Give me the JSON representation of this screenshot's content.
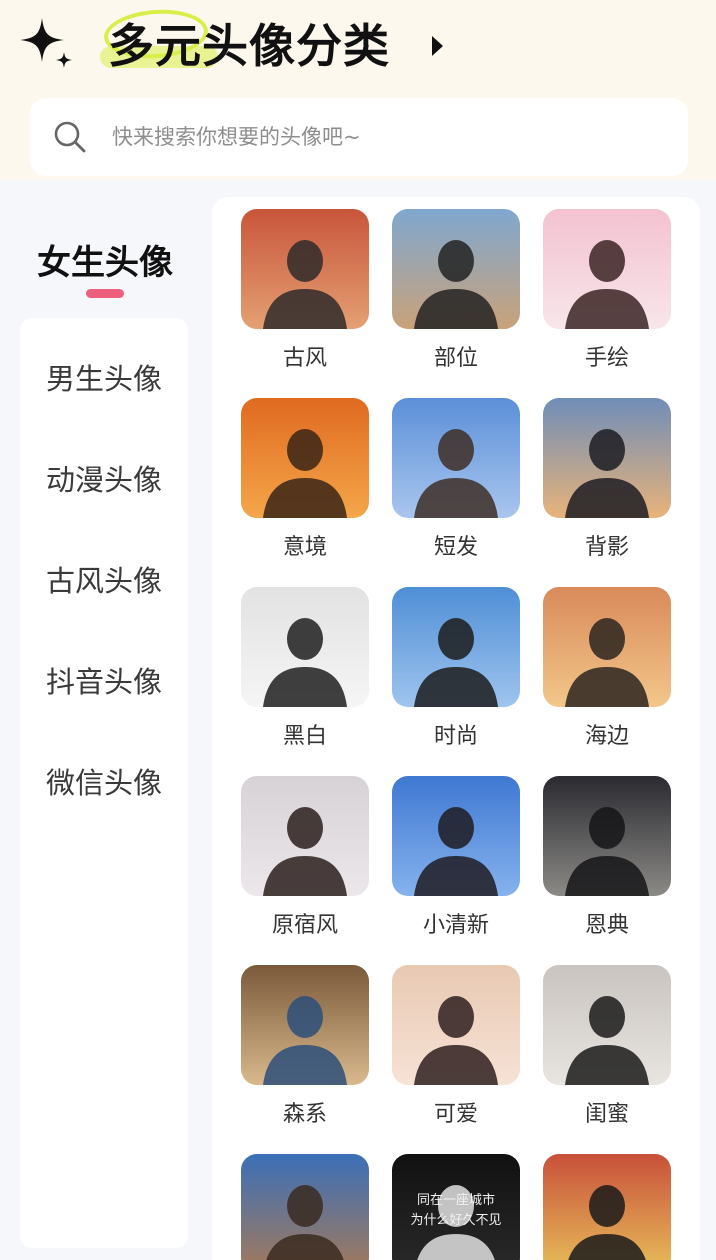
{
  "header": {
    "title": "多元头像分类",
    "accent_color": "#d8ef4a",
    "background": "#fdf8ee"
  },
  "search": {
    "placeholder": "快来搜索你想要的头像吧~",
    "icon": "search-icon"
  },
  "sidebar": {
    "active": {
      "label": "女生头像",
      "indicator_color": "#ee5f7e"
    },
    "items": [
      {
        "label": "男生头像"
      },
      {
        "label": "动漫头像"
      },
      {
        "label": "古风头像"
      },
      {
        "label": "抖音头像"
      },
      {
        "label": "微信头像"
      }
    ]
  },
  "categories": [
    {
      "label": "古风",
      "c1": "#c8553a",
      "c2": "#e4a073",
      "c3": "#2f2a2a"
    },
    {
      "label": "部位",
      "c1": "#7fa7cf",
      "c2": "#c9a27a",
      "c3": "#222222"
    },
    {
      "label": "手绘",
      "c1": "#f3c2d0",
      "c2": "#f7e6ea",
      "c3": "#3b2323"
    },
    {
      "label": "意境",
      "c1": "#e06a20",
      "c2": "#f4a64a",
      "c3": "#3a2416"
    },
    {
      "label": "短发",
      "c1": "#5b8fd8",
      "c2": "#a9c6ee",
      "c3": "#3e2e27"
    },
    {
      "label": "背影",
      "c1": "#6f8db8",
      "c2": "#e8b37a",
      "c3": "#1c1c22"
    },
    {
      "label": "黑白",
      "c1": "#e2e2e2",
      "c2": "#f5f5f5",
      "c3": "#1f1f1f"
    },
    {
      "label": "时尚",
      "c1": "#4f8fd6",
      "c2": "#9fc4ee",
      "c3": "#1c1c1c"
    },
    {
      "label": "海边",
      "c1": "#d98a5a",
      "c2": "#f2c78a",
      "c3": "#2b2420"
    },
    {
      "label": "原宿风",
      "c1": "#d7d2d6",
      "c2": "#ece7ea",
      "c3": "#2a1f1c"
    },
    {
      "label": "小清新",
      "c1": "#3f78d2",
      "c2": "#86b3ee",
      "c3": "#1e1b22"
    },
    {
      "label": "恩典",
      "c1": "#2a2a30",
      "c2": "#8c8a86",
      "c3": "#151518"
    },
    {
      "label": "森系",
      "c1": "#7a5a3a",
      "c2": "#d9b98c",
      "c3": "#2d4f7a"
    },
    {
      "label": "可爱",
      "c1": "#e8c9b2",
      "c2": "#f7e2d6",
      "c3": "#2e1e1e"
    },
    {
      "label": "闺蜜",
      "c1": "#c9c4bf",
      "c2": "#e8e4df",
      "c3": "#1a1a1a"
    },
    {
      "label": "",
      "c1": "#3b6fb8",
      "c2": "#a47a5a",
      "c3": "#3a2a20"
    },
    {
      "label": "",
      "c1": "#111111",
      "c2": "#2a2a2a",
      "c3": "#e0e0e0"
    },
    {
      "label": "",
      "c1": "#c8503a",
      "c2": "#e8c05a",
      "c3": "#1a1a1a"
    }
  ],
  "tile_texts": [
    {
      "index": 16,
      "lines": [
        "同在一座城市",
        "为什么好久不见"
      ]
    }
  ]
}
